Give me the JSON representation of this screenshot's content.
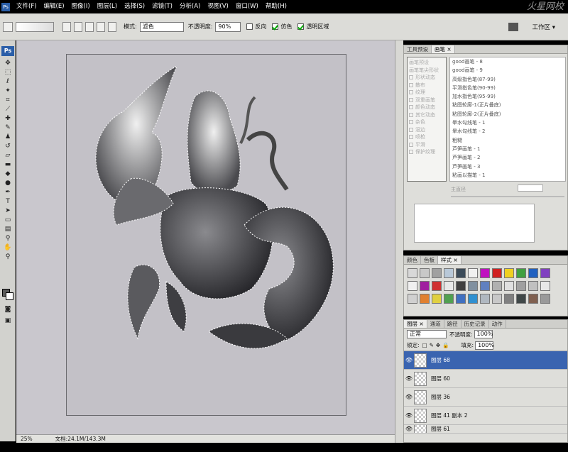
{
  "menu": {
    "items": [
      "文件(F)",
      "编辑(E)",
      "图像(I)",
      "图层(L)",
      "选择(S)",
      "滤镜(T)",
      "分析(A)",
      "视图(V)",
      "窗口(W)",
      "帮助(H)"
    ]
  },
  "watermark": "火星网校",
  "options": {
    "mode_label": "模式:",
    "mode_value": "滤色",
    "opacity_label": "不透明度:",
    "opacity_value": "90%",
    "reverse_label": "反向",
    "dither_label": "仿色",
    "transparency_label": "透明区域",
    "workspace_label": "工作区 ▾"
  },
  "status": {
    "zoom": "25%",
    "doc": "文档:24.1M/143.3M"
  },
  "brush_panel": {
    "tabs": [
      "工具预设",
      "画笔 ×"
    ],
    "left_items": [
      "画笔预设",
      "画笔笔尖形状",
      "形状动态",
      "散布",
      "纹理",
      "双重画笔",
      "颜色动态",
      "其它动态",
      "杂色",
      "湿边",
      "喷枪",
      "平滑",
      "保护纹理"
    ],
    "brushes": [
      "good画笔 - 8",
      "good画笔 - 9",
      "高级指色笔(87-99)",
      "平滑指色笔(90-99)",
      "加水指色笔(95-99)",
      "粘图轮廓-1(正片叠底)",
      "粘图轮廓-2(正片叠底)",
      "晕水勾线笔 - 1",
      "晕水勾线笔 - 2",
      "粗糙",
      "芦笋画笔 - 1",
      "芦笋画笔 - 2",
      "芦笋画笔 - 3",
      "粘画以描笔 - 1"
    ],
    "master_label": "主直径"
  },
  "styles_panel": {
    "tabs": [
      "颜色",
      "色板",
      "样式 ×"
    ],
    "swatches": [
      "#d8d8d8",
      "#c8c8c8",
      "#a0a0a0",
      "#b8c8d8",
      "#3a4a58",
      "#f0f0f0",
      "#c010c0",
      "#d02020",
      "#f0d020",
      "#40a040",
      "#2060c0",
      "#8040c0",
      "#f0f0f0",
      "#a020a0",
      "#d03030",
      "#e8e8e8",
      "#404040",
      "#8090a0",
      "#6080c0",
      "#b0b0b0",
      "#e0e0e0",
      "#a0a0a0",
      "#c0c0c0",
      "#e8e8e8",
      "#d0d0d0",
      "#e08030",
      "#e0d040",
      "#50a050",
      "#4070c0",
      "#3090d0",
      "#b0b8c0",
      "#c8c8c8",
      "#808080",
      "#404848",
      "#806050",
      "#9a9a9a"
    ]
  },
  "layers_panel": {
    "tabs": [
      "图层 ×",
      "通道",
      "路径",
      "历史记录",
      "动作"
    ],
    "blend": "正常",
    "opacity_label": "不透明度:",
    "opacity_value": "100%",
    "lock_label": "锁定:",
    "fill_label": "填充:",
    "fill_value": "100%",
    "layers": [
      "图层 68",
      "图层 60",
      "图层 36",
      "图层 41 副本 2",
      "图层 61"
    ],
    "selected": 0
  }
}
